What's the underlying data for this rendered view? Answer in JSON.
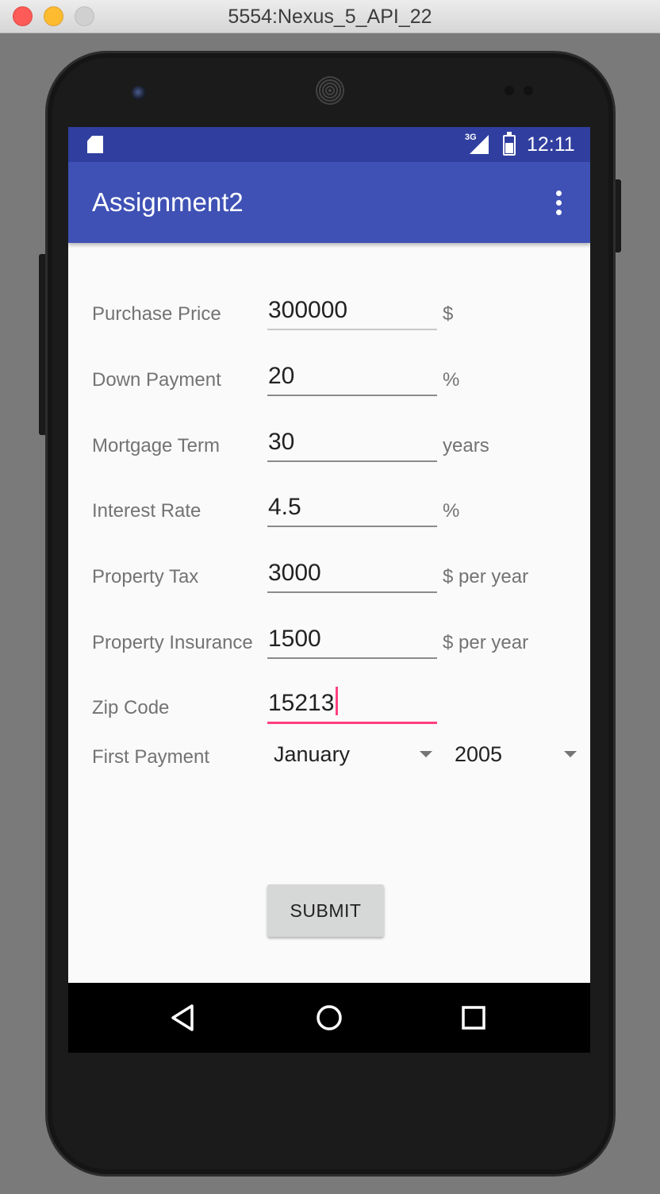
{
  "window": {
    "title": "5554:Nexus_5_API_22"
  },
  "status_bar": {
    "network_type": "3G",
    "time": "12:11"
  },
  "app_bar": {
    "title": "Assignment2"
  },
  "form": {
    "purchase_price": {
      "label": "Purchase Price",
      "value": "300000",
      "unit": "$"
    },
    "down_payment": {
      "label": "Down Payment",
      "value": "20",
      "unit": "%"
    },
    "mortgage_term": {
      "label": "Mortgage Term",
      "value": "30",
      "unit": "years"
    },
    "interest_rate": {
      "label": "Interest Rate",
      "value": "4.5",
      "unit": "%"
    },
    "property_tax": {
      "label": "Property Tax",
      "value": "3000",
      "unit": "$ per year"
    },
    "property_insurance": {
      "label": "Property Insurance",
      "value": "1500",
      "unit": "$ per year"
    },
    "zip_code": {
      "label": "Zip Code",
      "value": "15213"
    },
    "first_payment": {
      "label": "First Payment",
      "month": "January",
      "year": "2005"
    },
    "submit_label": "SUBMIT"
  },
  "colors": {
    "status_bar": "#303f9f",
    "app_bar": "#3f51b5",
    "accent": "#ff4081"
  }
}
